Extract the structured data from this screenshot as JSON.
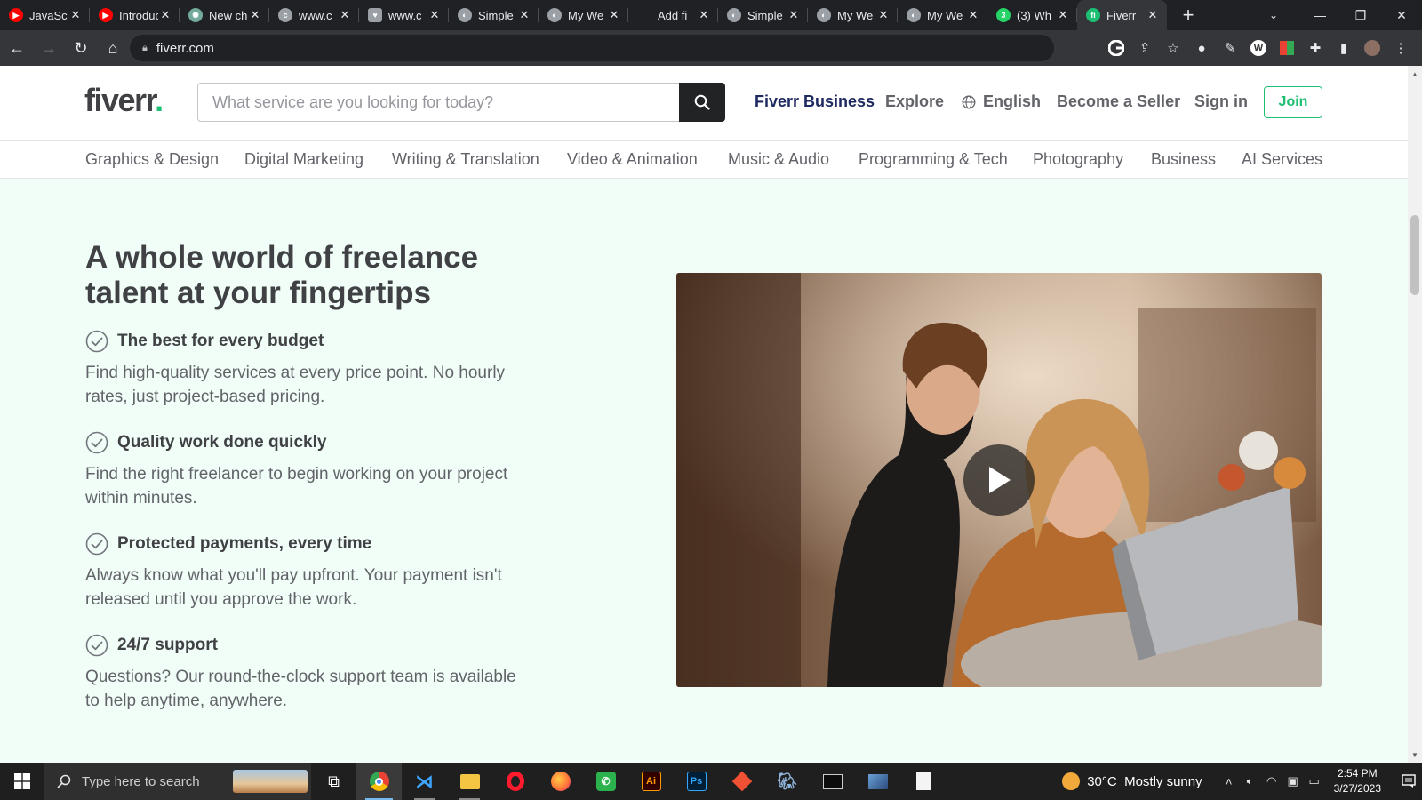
{
  "browser": {
    "tabs": [
      {
        "title": "JavaScript",
        "favicon": "youtube-icon",
        "color": "#ff0000"
      },
      {
        "title": "Introduction",
        "favicon": "youtube-icon",
        "color": "#ff0000"
      },
      {
        "title": "New chat",
        "favicon": "chatgpt-icon",
        "color": "#74aa9c"
      },
      {
        "title": "www.c",
        "favicon": "globe-icon",
        "color": "#9aa0a6"
      },
      {
        "title": "www.c",
        "favicon": "shield-icon",
        "color": "#9aa0a6"
      },
      {
        "title": "Simple",
        "favicon": "globe-icon",
        "color": "#9aa0a6"
      },
      {
        "title": "My We",
        "favicon": "globe-icon",
        "color": "#9aa0a6"
      },
      {
        "title": "Add fi",
        "favicon": "loading-icon",
        "color": "#202124"
      },
      {
        "title": "Simple",
        "favicon": "globe-icon",
        "color": "#9aa0a6"
      },
      {
        "title": "My We",
        "favicon": "globe-icon",
        "color": "#9aa0a6"
      },
      {
        "title": "My We",
        "favicon": "globe-icon",
        "color": "#9aa0a6"
      },
      {
        "title": "(3) Wh",
        "favicon": "whatsapp-icon",
        "color": "#25d366"
      },
      {
        "title": "Fiverr",
        "favicon": "fiverr-icon",
        "color": "#1dbf73"
      }
    ],
    "active_tab_index": 12,
    "url": "fiverr.com"
  },
  "header": {
    "logo_text": "fiverr",
    "logo_dot": ".",
    "search_placeholder": "What service are you looking for today?",
    "nav": {
      "business": "Fiverr Business",
      "explore": "Explore",
      "language": "English",
      "become_seller": "Become a Seller",
      "sign_in": "Sign in",
      "join": "Join"
    }
  },
  "categories": [
    "Graphics & Design",
    "Digital Marketing",
    "Writing & Translation",
    "Video & Animation",
    "Music & Audio",
    "Programming & Tech",
    "Photography",
    "Business",
    "AI Services"
  ],
  "main": {
    "headline": "A whole world of freelance talent at your fingertips",
    "features": [
      {
        "title": "The best for every budget",
        "desc": "Find high-quality services at every price point. No hourly rates, just project-based pricing."
      },
      {
        "title": "Quality work done quickly",
        "desc": "Find the right freelancer to begin working on your project within minutes."
      },
      {
        "title": "Protected payments, every time",
        "desc": "Always know what you'll pay upfront. Your payment isn't released until you approve the work."
      },
      {
        "title": "24/7 support",
        "desc": "Questions? Our round-the-clock support team is available to help anytime, anywhere."
      }
    ]
  },
  "taskbar": {
    "search_placeholder": "Type here to search",
    "weather": "30°C  Mostly sunny",
    "time": "2:54 PM",
    "date": "3/27/2023"
  },
  "colors": {
    "brand_green": "#1dbf73",
    "business_navy": "#1f2a62",
    "section_bg": "#f1fdf7",
    "text_dark": "#404145",
    "text_muted": "#62646a"
  }
}
